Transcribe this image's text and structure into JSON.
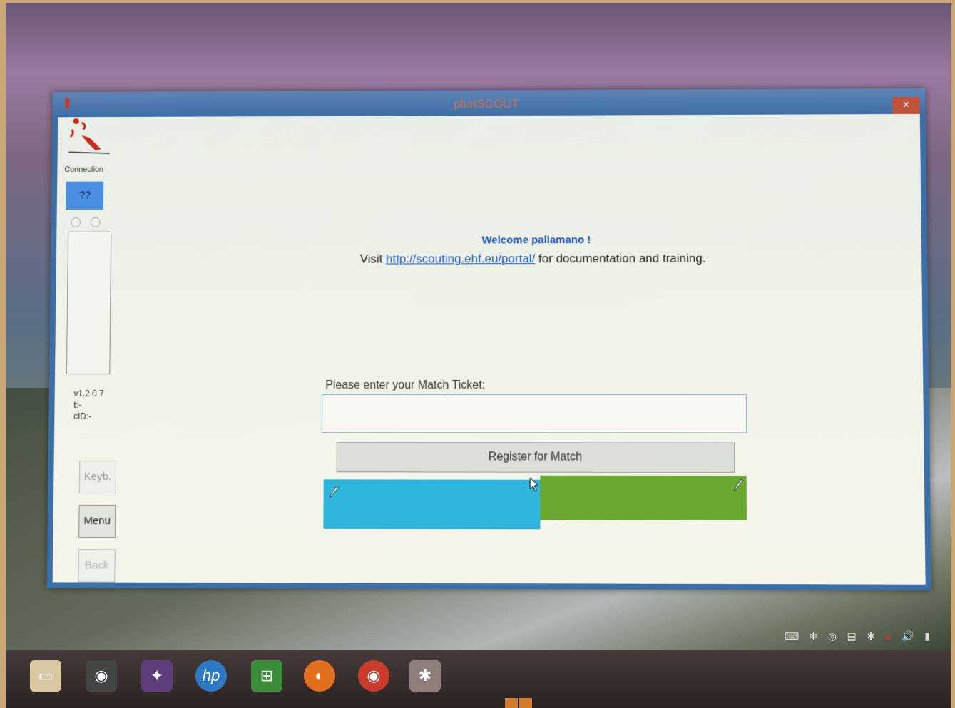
{
  "window": {
    "title": "pluriSCOUT",
    "close_glyph": "×"
  },
  "sidebar": {
    "connection_label": "Connection",
    "connection_status": "??",
    "version": "v1.2.0.7",
    "t_info": "t:-",
    "cid_info": "cID:-",
    "keyboard_button": "Keyb.",
    "menu_button": "Menu",
    "back_button": "Back"
  },
  "main": {
    "welcome": "Welcome pallamano !",
    "visit_prefix": "Visit",
    "portal_link": "http://scouting.ehf.eu/portal/",
    "visit_suffix": "for documentation and training.",
    "ticket_label": "Please enter your Match Ticket:",
    "ticket_value": "",
    "register_button": "Register for Match"
  },
  "colors": {
    "team_a": "#2fb6dc",
    "team_b": "#6aa832",
    "connection_box": "#4a8fe0",
    "close_button": "#c0513b"
  },
  "taskbar": {
    "apps": [
      "file-explorer-icon",
      "webcam-icon",
      "photo-app-icon",
      "hp-icon",
      "store-icon",
      "firefox-icon",
      "chrome-icon",
      "pluriscout-app-icon"
    ],
    "tray_icons": [
      "touch-keyboard-icon",
      "network-icon",
      "sync-icon",
      "storage-icon",
      "bluetooth-icon",
      "antivirus-icon",
      "volume-icon",
      "battery-icon"
    ]
  }
}
